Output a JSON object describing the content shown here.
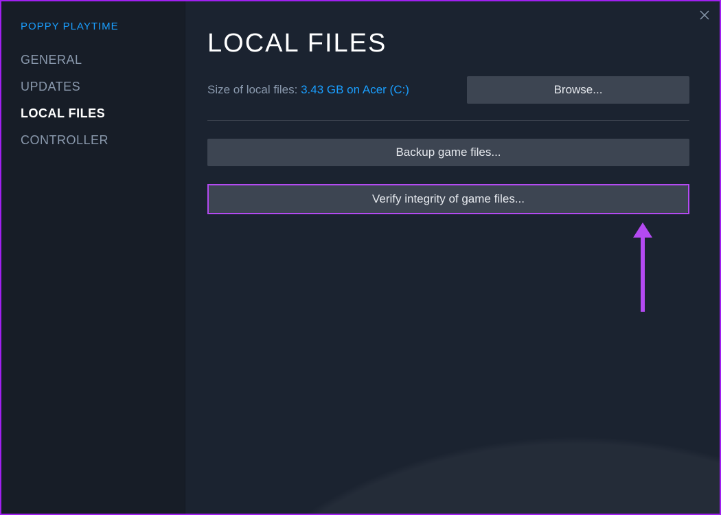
{
  "sidebar": {
    "game_title": "POPPY PLAYTIME",
    "items": [
      {
        "label": "GENERAL",
        "active": false
      },
      {
        "label": "UPDATES",
        "active": false
      },
      {
        "label": "LOCAL FILES",
        "active": true
      },
      {
        "label": "CONTROLLER",
        "active": false
      }
    ]
  },
  "content": {
    "heading": "LOCAL FILES",
    "size_label": "Size of local files: ",
    "size_value": "3.43 GB on Acer (C:)",
    "browse_label": "Browse...",
    "backup_label": "Backup game files...",
    "verify_label": "Verify integrity of game files..."
  },
  "annotation": {
    "highlight_color": "#b44af2"
  }
}
